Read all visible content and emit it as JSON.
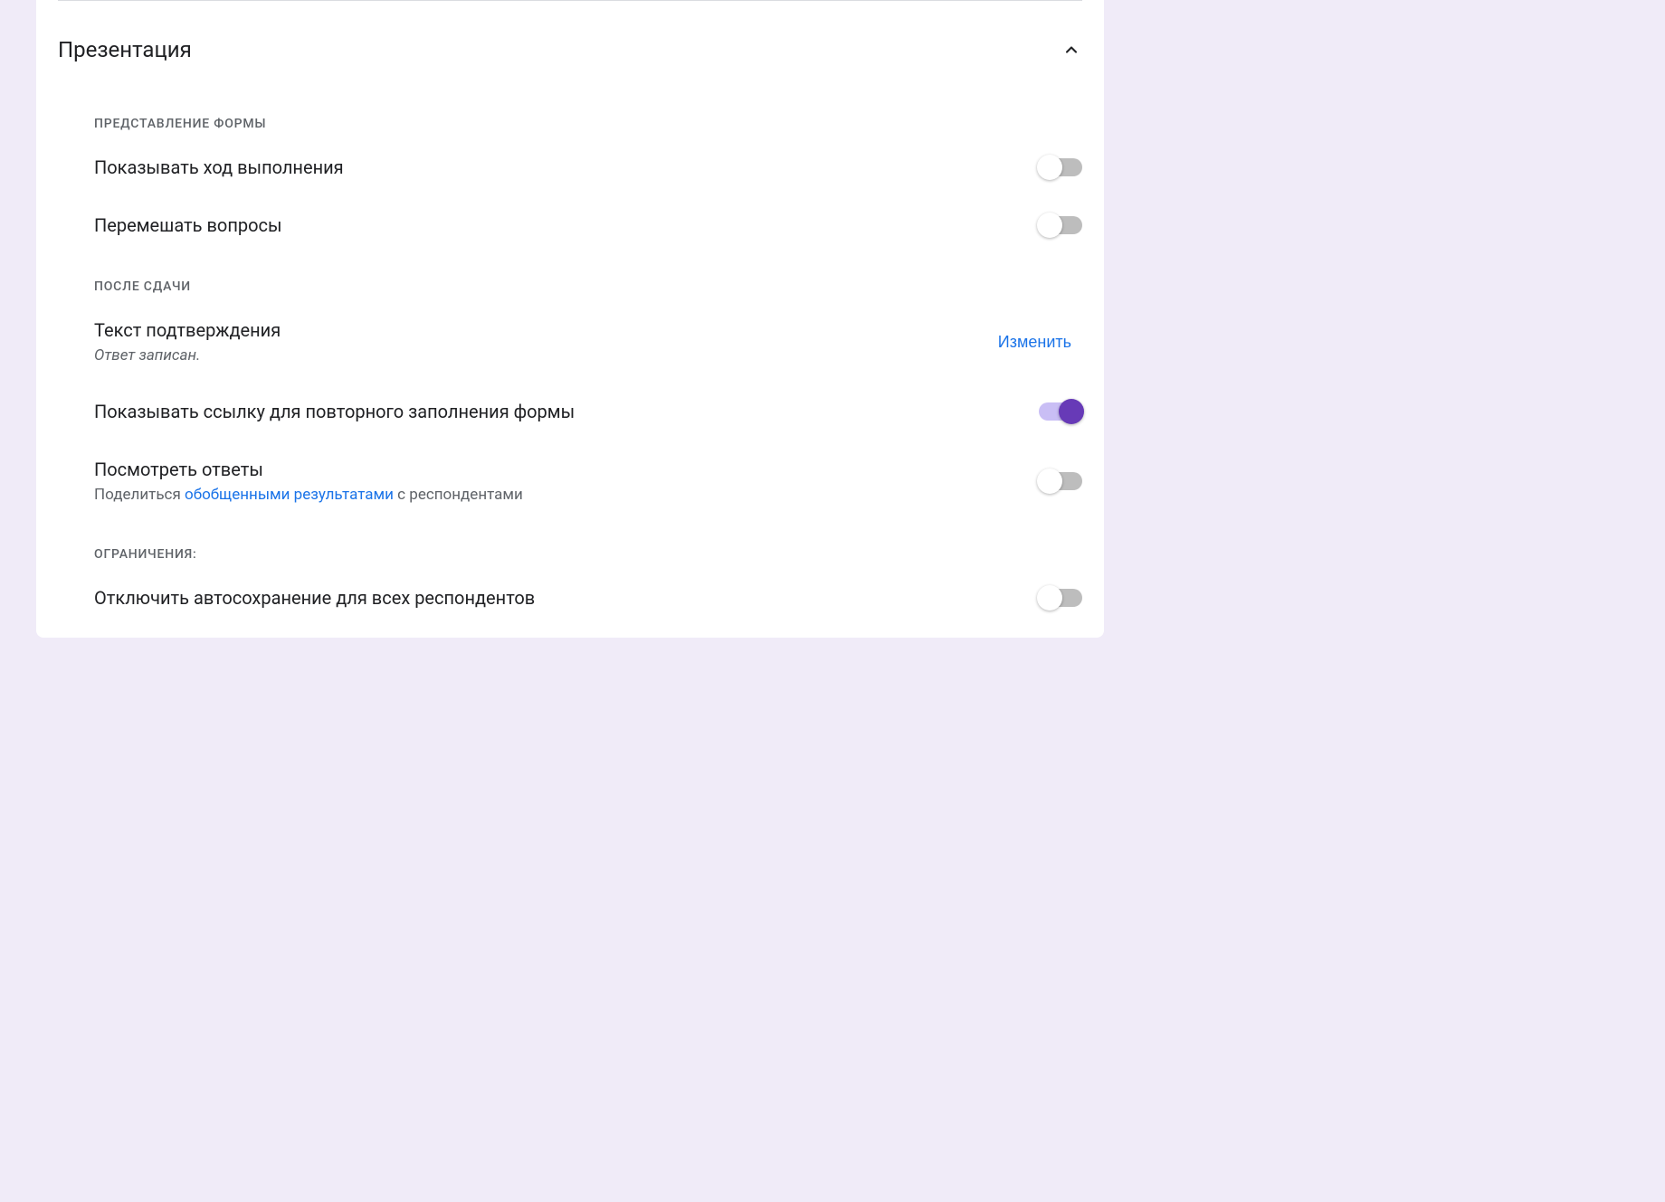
{
  "section": {
    "title": "Презентация"
  },
  "subsections": {
    "form_presentation": {
      "label": "ПРЕДСТАВЛЕНИЕ ФОРМЫ",
      "show_progress": {
        "title": "Показывать ход выполнения"
      },
      "shuffle_questions": {
        "title": "Перемешать вопросы"
      }
    },
    "after_submit": {
      "label": "ПОСЛЕ СДАЧИ",
      "confirmation": {
        "title": "Текст подтверждения",
        "subtitle": "Ответ записан.",
        "edit_button": "Изменить"
      },
      "resubmit_link": {
        "title": "Показывать ссылку для повторного заполнения формы"
      },
      "view_results": {
        "title": "Посмотреть ответы",
        "subtitle_prefix": "Поделиться ",
        "subtitle_link": "обобщенными результатами",
        "subtitle_suffix": " с респондентами"
      }
    },
    "restrictions": {
      "label": "ОГРАНИЧЕНИЯ:",
      "disable_autosave": {
        "title": "Отключить автосохранение для всех респондентов"
      }
    }
  }
}
